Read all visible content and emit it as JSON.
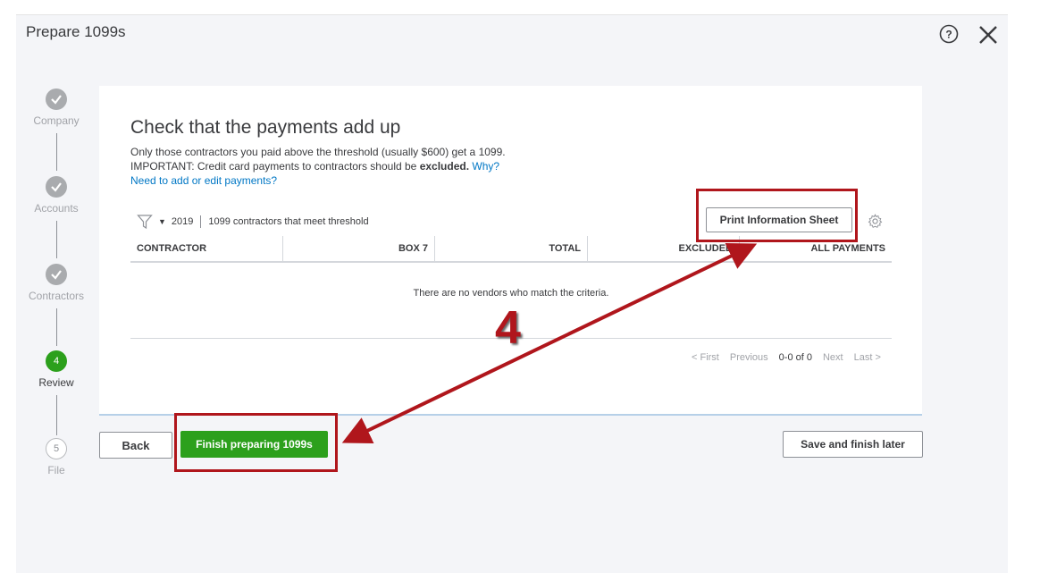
{
  "header": {
    "title": "Prepare 1099s"
  },
  "stepper": {
    "steps": [
      {
        "label": "Company",
        "state": "done",
        "icon": "check-icon"
      },
      {
        "label": "Accounts",
        "state": "done",
        "icon": "check-icon"
      },
      {
        "label": "Contractors",
        "state": "done",
        "icon": "check-icon"
      },
      {
        "label": "Review",
        "state": "current",
        "number": "4"
      },
      {
        "label": "File",
        "state": "future",
        "number": "5"
      }
    ]
  },
  "main": {
    "heading": "Check that the payments add up",
    "desc_line1": "Only those contractors you paid above the threshold (usually $600) get a 1099.",
    "desc_line2_prefix": "IMPORTANT: Credit card payments to contractors should be ",
    "desc_line2_bold": "excluded.",
    "desc_line2_link": "Why?",
    "desc_link": "Need to add or edit payments?"
  },
  "filter": {
    "year": "2019",
    "description": "1099 contractors that meet threshold",
    "icon": "filter-icon"
  },
  "toolbar": {
    "print_label": "Print Information Sheet",
    "settings_icon": "gear-icon"
  },
  "table": {
    "columns": [
      "CONTRACTOR",
      "BOX 7",
      "TOTAL",
      "EXCLUDED",
      "ALL PAYMENTS"
    ],
    "empty_message": "There are no vendors who match the criteria."
  },
  "pager": {
    "first": "< First",
    "previous": "Previous",
    "count": "0-0 of 0",
    "next": "Next",
    "last": "Last >"
  },
  "footer": {
    "back_label": "Back",
    "finish_label": "Finish preparing 1099s",
    "save_label": "Save and finish later"
  },
  "annotation": {
    "step_number": "4",
    "color": "#b0161c"
  },
  "colors": {
    "accent_green": "#2ca01c",
    "link_blue": "#0077c5",
    "background": "#f4f5f8"
  }
}
